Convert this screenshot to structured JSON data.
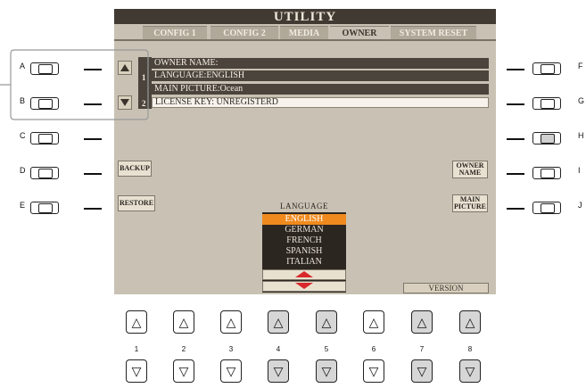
{
  "screen": {
    "title": "UTILITY",
    "tabs": [
      {
        "label": "CONFIG 1",
        "active": false
      },
      {
        "label": "CONFIG 2",
        "active": false
      },
      {
        "label": "MEDIA",
        "active": false
      },
      {
        "label": "OWNER",
        "active": true
      },
      {
        "label": "SYSTEM RESET",
        "active": false
      }
    ],
    "info_rows": [
      "OWNER NAME:",
      "LANGUAGE:ENGLISH",
      "MAIN PICTURE:Ocean",
      "LICENSE KEY: UNREGISTERD"
    ],
    "row_numbers": [
      "1",
      "2"
    ],
    "buttons": {
      "backup": "BACKUP",
      "restore": "RESTORE",
      "owner_name": [
        "OWNER",
        "NAME"
      ],
      "main_picture": [
        "MAIN",
        "PICTURE"
      ],
      "version": "VERSION"
    },
    "language": {
      "title": "LANGUAGE",
      "options": [
        "ENGLISH",
        "GERMAN",
        "FRENCH",
        "SPANISH",
        "ITALIAN"
      ],
      "selected": "ENGLISH"
    }
  },
  "panel": {
    "left_labels": [
      "A",
      "B",
      "C",
      "D",
      "E"
    ],
    "right_labels": [
      "F",
      "G",
      "H",
      "I",
      "J"
    ],
    "lower_labels": [
      "1",
      "2",
      "3",
      "4",
      "5",
      "6",
      "7",
      "8"
    ],
    "up_glyph": "△",
    "down_glyph": "▽"
  },
  "colors": {
    "lcd_background": "#c9c2b4",
    "title_bar": "#413a33",
    "selected_language": "#f08a1e",
    "accent_arrow": "#d8282b"
  }
}
